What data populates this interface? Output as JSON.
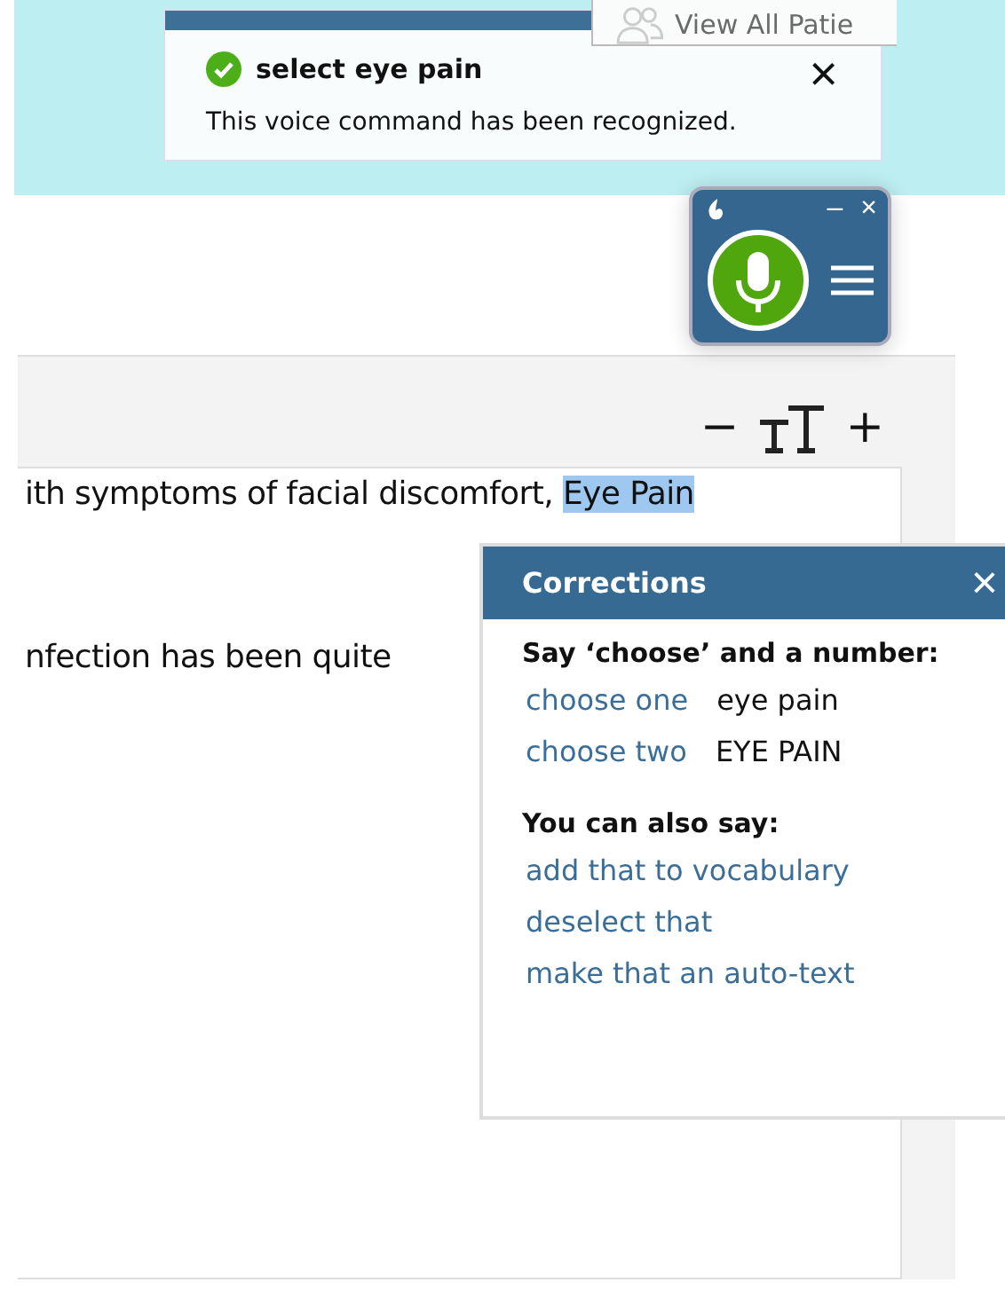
{
  "background_button": {
    "label": "View All Patie"
  },
  "toast": {
    "title": "select eye pain",
    "message": "This voice command has been recognized.",
    "close": "×"
  },
  "dragon_bar": {
    "minimize": "–",
    "close": "×"
  },
  "editor": {
    "toolbar": {
      "decrease": "−",
      "increase": "+"
    },
    "lines": [
      {
        "text": "ith symptoms of facial discomfort, ",
        "selected_text": "Eye Pain"
      },
      {
        "text": "nfection has been quite"
      }
    ]
  },
  "corrections": {
    "title": "Corrections",
    "close": "×",
    "choose_heading": "Say ‘choose’ and a number:",
    "choices": [
      {
        "command": "choose one",
        "result": "eye pain"
      },
      {
        "command": "choose two",
        "result": "EYE PAIN"
      }
    ],
    "also_heading": "You can also say:",
    "commands": [
      "add that to vocabulary",
      "deselect that",
      "make that an auto-text"
    ]
  }
}
